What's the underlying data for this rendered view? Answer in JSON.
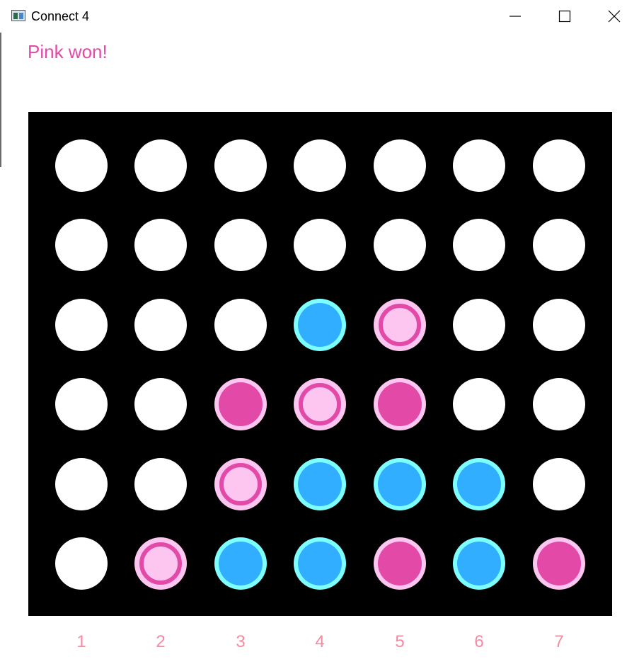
{
  "window": {
    "title": "Connect 4"
  },
  "status": {
    "text": "Pink won!",
    "color": "#e34aa8"
  },
  "colors": {
    "board": "#000000",
    "empty": "#ffffff",
    "pink_fill": "#e34aa8",
    "pink_ring": "#fdc6f1",
    "blue_fill": "#31aeff",
    "blue_ring": "#7effff",
    "win_fill": "#fdc6f1",
    "win_ring": "#e34aa8",
    "column_label": "#f58aa0"
  },
  "board": {
    "rows": [
      [
        "empty",
        "empty",
        "empty",
        "empty",
        "empty",
        "empty",
        "empty"
      ],
      [
        "empty",
        "empty",
        "empty",
        "empty",
        "empty",
        "empty",
        "empty"
      ],
      [
        "empty",
        "empty",
        "empty",
        "blue",
        "pink-win",
        "empty",
        "empty"
      ],
      [
        "empty",
        "empty",
        "pink",
        "pink-win",
        "pink",
        "empty",
        "empty"
      ],
      [
        "empty",
        "empty",
        "pink-win",
        "blue",
        "blue",
        "blue",
        "empty"
      ],
      [
        "empty",
        "pink-win",
        "blue",
        "blue",
        "pink",
        "blue",
        "pink"
      ]
    ],
    "column_labels": [
      "1",
      "2",
      "3",
      "4",
      "5",
      "6",
      "7"
    ]
  },
  "icons": {
    "app": "app-window-icon",
    "minimize": "minimize-icon",
    "maximize": "maximize-icon",
    "close": "close-icon"
  }
}
